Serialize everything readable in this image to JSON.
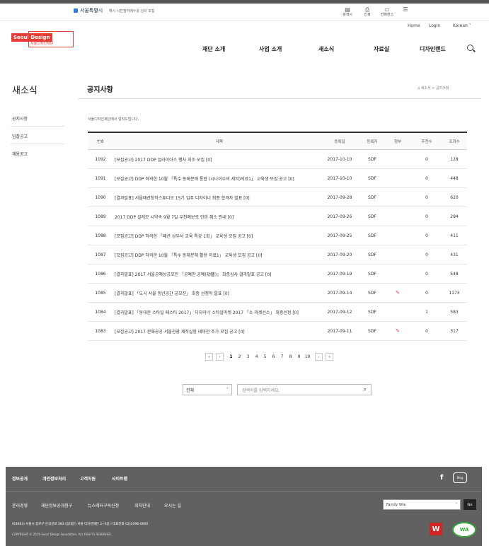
{
  "util": {
    "seoul_name": "서울특별시",
    "tagline": "해시 시민참여예수를 강의 모집",
    "quick": [
      {
        "label": "검색시",
        "icon": "document-icon"
      },
      {
        "label": "인쇄",
        "icon": "print-icon"
      },
      {
        "label": "컨퍼런스",
        "icon": "monitor-icon"
      },
      {
        "label": "",
        "icon": "menu-icon"
      }
    ]
  },
  "logo": {
    "text": "Seoul Design",
    "sub": "서울디자인재단"
  },
  "header_links": {
    "home": "Home",
    "login": "Login",
    "lang": "Korean"
  },
  "gnb": [
    "재단 소개",
    "사업 소개",
    "새소식",
    "자료실",
    "디자인랜드"
  ],
  "side": {
    "title": "새소식",
    "items": [
      "공지사항",
      "입찰공고",
      "채용공고"
    ]
  },
  "page": {
    "title": "공지사항",
    "breadcrumb": "새소식 > 공지사항",
    "description": "서울디자인재단에서 알려드립니다."
  },
  "table": {
    "headers": [
      "번호",
      "제목",
      "등록일",
      "등록자",
      "첨부",
      "추천수",
      "조회수"
    ],
    "rows": [
      {
        "num": "1092",
        "title": "[모집공고] 2017 DDP 얼라이어스 행사 지조 모집  [0]",
        "date": "2017-10-10",
        "author": "SDF",
        "file": "",
        "rec": "0",
        "view": "128"
      },
      {
        "num": "1091",
        "title": "[모집공고] DDP 하의한 10월 「특수 동체분해 통합 (시나이우의 세막)의료1」 교육생 모집 공고  [0]",
        "date": "2017-10-10",
        "author": "SDF",
        "file": "",
        "rec": "0",
        "view": "448"
      },
      {
        "num": "1090",
        "title": "[결과발표] 서울패션창작스튜디오 15기 입주 디자이너 최종 합격자 발표  [0]",
        "date": "2017-09-28",
        "author": "SDF",
        "file": "",
        "rec": "0",
        "view": "620"
      },
      {
        "num": "1089",
        "title": "2017 DDP 설레모 시약속 9월 7일 우천예보로 인한 취소 안내  [0]",
        "date": "2017-09-26",
        "author": "SDF",
        "file": "",
        "rec": "0",
        "view": "284"
      },
      {
        "num": "1088",
        "title": "[모집공고] DDP 하의한 「패션 상우서 교육 특강 1회」 교육생 모집 공고  [0]",
        "date": "2017-09-25",
        "author": "SDF",
        "file": "",
        "rec": "0",
        "view": "411"
      },
      {
        "num": "1087",
        "title": "[모집공고] DDP 하의한 10월 「특수 동체분해 활용 의료1」 교육생 모집 공고  [0]",
        "date": "2017-09-20",
        "author": "SDF",
        "file": "",
        "rec": "0",
        "view": "431"
      },
      {
        "num": "1086",
        "title": "[결과발표] 2017 서울공예상공모전 「공예한 공예(功藝)」 최종심사 결과발표 공고  [0]",
        "date": "2017-09-19",
        "author": "SDF",
        "file": "",
        "rec": "0",
        "view": "548"
      },
      {
        "num": "1085",
        "title": "[결과발표] 「도시 서울 청년공간 공모전」 최종 선정작 발표  [0]",
        "date": "2017-09-14",
        "author": "SDF",
        "file": "attach",
        "rec": "0",
        "view": "1173"
      },
      {
        "num": "1084",
        "title": "[결과발표] 「동대문 스타일 페스티 2017」 디자이너 스타일마켓 2017 「소 마켓선스」 최종선정  [0]",
        "date": "2017-09-12",
        "author": "SDF",
        "file": "",
        "rec": "1",
        "view": "583"
      },
      {
        "num": "1083",
        "title": "[모집공고] 2017 문화공공 서울관광 제작실험 테마전 추가 모집 공고  [0]",
        "date": "2017-09-11",
        "author": "SDF",
        "file": "attach",
        "rec": "0",
        "view": "317"
      }
    ]
  },
  "pager": {
    "pages": [
      "1",
      "2",
      "3",
      "4",
      "5",
      "6",
      "7",
      "8",
      "9",
      "10"
    ],
    "current": "1",
    "first": "«",
    "prev": "‹",
    "next": "›",
    "last": "»"
  },
  "search": {
    "select": "전체",
    "placeholder": "검색어를 입력하세요."
  },
  "footer": {
    "nav": [
      "정보공개",
      "개인정보처리",
      "고객지원",
      "사이트맵"
    ],
    "nav2": [
      "윤리경영",
      "재단정보공개청구",
      "뉴스레터구독신청",
      "위치안내",
      "오시는 길"
    ],
    "family": "Family Site",
    "go": "Go",
    "address": "(03083) 서울시 종로구 돈의문로 283 (동대문) 서울 디자인재단 2~5층 / 대표전화 02)2096-0000",
    "copyright": "COPYRIGHT © 2016 Seoul Design Foundation. ALL RIGHTS RESERVED.",
    "blog": "Blog",
    "wa_mark": "W"
  }
}
